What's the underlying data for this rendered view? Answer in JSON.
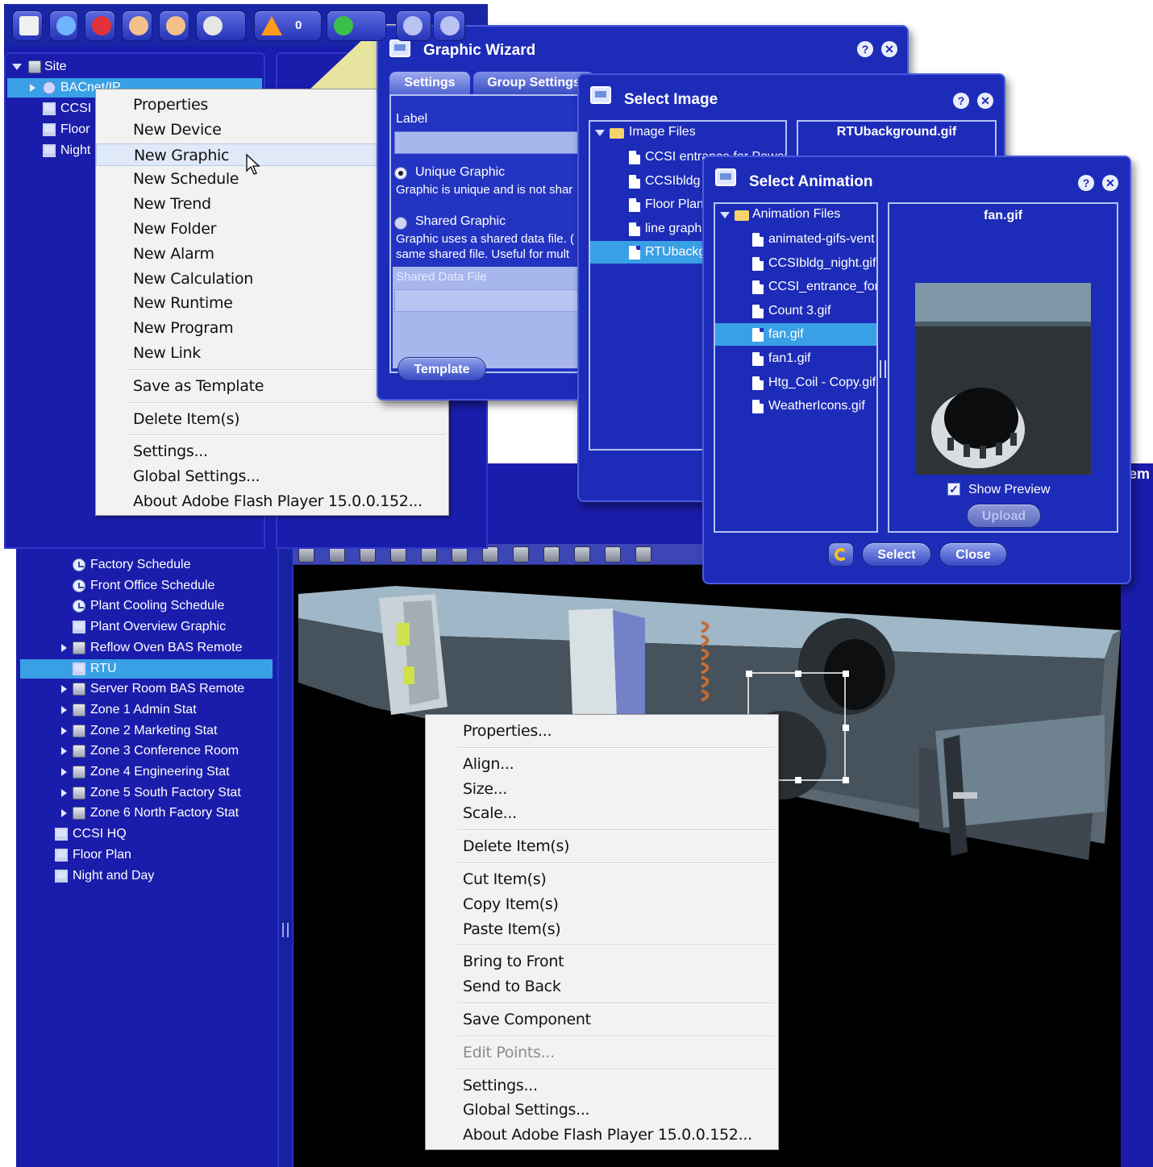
{
  "top_toolbar": {
    "alarm_count": "0",
    "icons": [
      "home-icon",
      "info-icon",
      "alarm-wheel-icon",
      "user-icon",
      "users-icon",
      "tools-icon",
      "warning-icon",
      "run-icon",
      "window-icon",
      "help-icon"
    ]
  },
  "top_tree": {
    "root": "Site",
    "items": [
      {
        "label": "BACnet/IP"
      },
      {
        "label": "CCSI"
      },
      {
        "label": "Floor"
      },
      {
        "label": "Night"
      }
    ]
  },
  "context_menu_top": {
    "groups": [
      [
        "Properties",
        "New Device",
        "New Graphic",
        "New Schedule",
        "New Trend",
        "New Folder",
        "New Alarm",
        "New Calculation",
        "New Runtime",
        "New Program",
        "New Link"
      ],
      [
        "Save as Template"
      ],
      [
        "Delete Item(s)"
      ],
      [
        "Settings...",
        "Global Settings...",
        "About Adobe Flash Player 15.0.0.152..."
      ]
    ],
    "highlighted": "New Graphic"
  },
  "graphic_wizard": {
    "title": "Graphic Wizard",
    "tabs": [
      "Settings",
      "Group Settings"
    ],
    "label_caption": "Label",
    "unique_option": "Unique Graphic",
    "unique_desc": "Graphic is unique and is not shar",
    "shared_option": "Shared Graphic",
    "shared_desc_1": "Graphic uses a shared data file. (",
    "shared_desc_2": "same shared file.  Useful for mult",
    "shared_file_caption": "Shared Data File",
    "template_button": "Template"
  },
  "select_image": {
    "title": "Select Image",
    "folder": "Image Files",
    "files": [
      "CCSI entrance for Power",
      "CCSIbldg",
      "Floor Plan",
      "line graph",
      "RTUbackg"
    ],
    "selected_file": "RTUbackg",
    "preview_title": "RTUbackground.gif"
  },
  "select_animation": {
    "title": "Select Animation",
    "folder": "Animation Files",
    "files": [
      "animated-gifs-vent",
      "CCSIbldg_night.gif",
      "CCSI_entrance_for",
      "Count 3.gif",
      "fan.gif",
      "fan1.gif",
      "Htg_Coil - Copy.gif",
      "WeatherIcons.gif"
    ],
    "selected_file": "fan.gif",
    "preview_title": "fan.gif",
    "show_preview_label": "Show Preview",
    "upload_button": "Upload",
    "select_button": "Select",
    "close_button": "Close"
  },
  "bottom_tree": {
    "items": [
      {
        "label": "Factory Schedule",
        "icon": "clock-icon",
        "expandable": false,
        "indent": 2
      },
      {
        "label": "Front Office Schedule",
        "icon": "clock-icon",
        "expandable": false,
        "indent": 2
      },
      {
        "label": "Plant Cooling Schedule",
        "icon": "clock-icon",
        "expandable": false,
        "indent": 2
      },
      {
        "label": "Plant Overview Graphic",
        "icon": "monitor-icon",
        "expandable": false,
        "indent": 2
      },
      {
        "label": "Reflow Oven BAS Remote",
        "icon": "device-icon",
        "expandable": true,
        "indent": 2
      },
      {
        "label": "RTU",
        "icon": "monitor-icon",
        "expandable": false,
        "indent": 2,
        "selected": true
      },
      {
        "label": "Server Room BAS Remote",
        "icon": "device-icon",
        "expandable": true,
        "indent": 2
      },
      {
        "label": "Zone 1 Admin Stat",
        "icon": "device-icon",
        "expandable": true,
        "indent": 2
      },
      {
        "label": "Zone 2 Marketing Stat",
        "icon": "device-icon",
        "expandable": true,
        "indent": 2
      },
      {
        "label": "Zone 3 Conference Room",
        "icon": "device-icon",
        "expandable": true,
        "indent": 2
      },
      {
        "label": "Zone 4 Engineering Stat",
        "icon": "device-icon",
        "expandable": true,
        "indent": 2
      },
      {
        "label": "Zone 5 South Factory Stat",
        "icon": "device-icon",
        "expandable": true,
        "indent": 2
      },
      {
        "label": "Zone 6 North Factory Stat",
        "icon": "device-icon",
        "expandable": true,
        "indent": 2
      },
      {
        "label": "CCSI HQ",
        "icon": "monitor-icon",
        "expandable": false,
        "indent": 1
      },
      {
        "label": "Floor Plan",
        "icon": "monitor-icon",
        "expandable": false,
        "indent": 1
      },
      {
        "label": "Night and Day",
        "icon": "monitor-icon",
        "expandable": false,
        "indent": 1
      }
    ]
  },
  "canvas_toolbar": {
    "icons": [
      "monitor-icon",
      "folder-icon",
      "check-icon",
      "align-icon",
      "select-icon",
      "cut-icon",
      "copy-icon",
      "paste-icon",
      "delete-icon",
      "zoom-icon",
      "grid-icon",
      "settings-icon"
    ]
  },
  "context_menu_bottom": {
    "groups": [
      [
        "Properties..."
      ],
      [
        "Align...",
        "Size...",
        "Scale..."
      ],
      [
        "Delete Item(s)"
      ],
      [
        "Cut Item(s)",
        "Copy Item(s)",
        "Paste Item(s)"
      ],
      [
        "Bring to Front",
        "Send to Back"
      ],
      [
        "Save Component"
      ],
      [
        "Edit Points..."
      ],
      [
        "Settings...",
        "Global Settings...",
        "About Adobe Flash Player 15.0.0.152..."
      ]
    ],
    "disabled": [
      "Edit Points..."
    ]
  },
  "colors": {
    "app_blue": "#1a1dab",
    "dialog_blue": "#1d2cb8",
    "selection": "#3aa0e6",
    "menu_bg": "#f2f2f2",
    "beam_yellow": "#f7f59c"
  },
  "partial_text_right_edge": "em"
}
